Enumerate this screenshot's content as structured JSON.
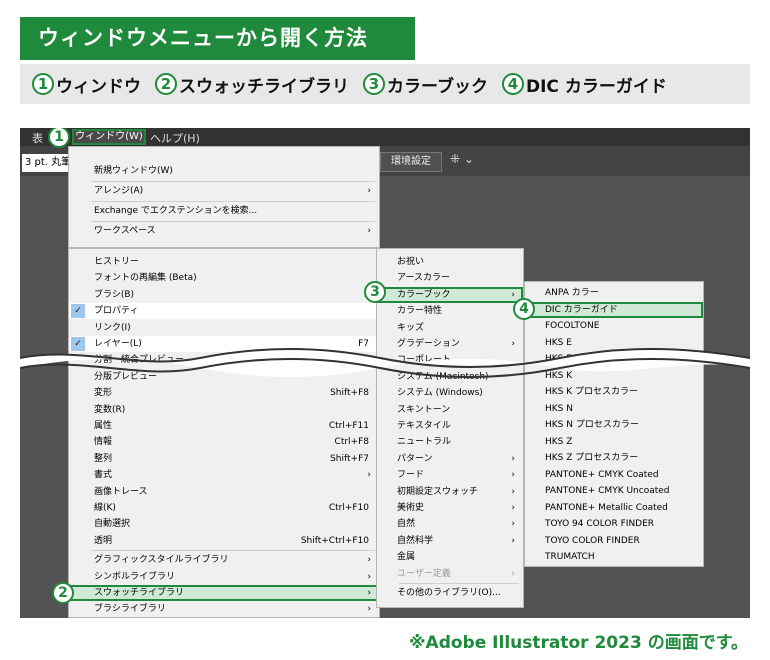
{
  "banner": "ウィンドウメニューから開く方法",
  "steps": [
    {
      "num": "1",
      "label": "ウィンドウ"
    },
    {
      "num": "2",
      "label": "スウォッチライブラリ"
    },
    {
      "num": "3",
      "label": "カラーブック"
    },
    {
      "num": "4",
      "label": "DIC カラーガイド"
    }
  ],
  "menubar": {
    "left_fragment": "表",
    "window": "ウィンドウ(W)",
    "help": "ヘルプ(H)"
  },
  "toolbar": {
    "stroke_field": "3 pt. 丸筆",
    "env_button": "環境設定"
  },
  "window_menu_top": [
    {
      "label": "新規ウィンドウ(W)"
    },
    {
      "label": "アレンジ(A)",
      "submenu": true
    },
    {
      "label": "Exchange でエクステンションを検索..."
    },
    {
      "label": "ワークスペース",
      "submenu": true
    }
  ],
  "window_menu": [
    {
      "label": "ヒストリー"
    },
    {
      "label": "フォントの再編集 (Beta)"
    },
    {
      "label": "ブラシ(B)",
      "shortcut": "F"
    },
    {
      "label": "プロパティ",
      "checked": true
    },
    {
      "label": "リンク(I)"
    },
    {
      "label": "レイヤー(L)",
      "shortcut": "F7",
      "checked": true
    },
    {
      "label": "分割・統合プレビュー"
    },
    {
      "label": "分版プレビュー"
    },
    {
      "label": "変形",
      "shortcut": "Shift+F8"
    },
    {
      "label": "変数(R)"
    },
    {
      "label": "属性",
      "shortcut": "Ctrl+F11"
    },
    {
      "label": "情報",
      "shortcut": "Ctrl+F8"
    },
    {
      "label": "整列",
      "shortcut": "Shift+F7"
    },
    {
      "label": "書式",
      "submenu": true
    },
    {
      "label": "画像トレース"
    },
    {
      "label": "線(K)",
      "shortcut": "Ctrl+F10"
    },
    {
      "label": "自動選択"
    },
    {
      "label": "透明",
      "shortcut": "Shift+Ctrl+F10"
    },
    {
      "label": "グラフィックスタイルライブラリ",
      "submenu": true
    },
    {
      "label": "シンボルライブラリ",
      "submenu": true
    },
    {
      "label": "スウォッチライブラリ",
      "submenu": true,
      "highlight": true
    },
    {
      "label": "ブラシライブラリ",
      "submenu": true
    }
  ],
  "swatch_menu": [
    {
      "label": "お祝い"
    },
    {
      "label": "アースカラー"
    },
    {
      "label": "カラーブック",
      "submenu": true,
      "highlight": true
    },
    {
      "label": "カラー特性"
    },
    {
      "label": "キッズ"
    },
    {
      "label": "グラデーション",
      "submenu": true
    },
    {
      "label": "コーポレート"
    },
    {
      "label": "システム (Macintosh)"
    },
    {
      "label": "システム (Windows)"
    },
    {
      "label": "スキントーン"
    },
    {
      "label": "テキスタイル"
    },
    {
      "label": "ニュートラル"
    },
    {
      "label": "パターン",
      "submenu": true
    },
    {
      "label": "フード",
      "submenu": true
    },
    {
      "label": "初期設定スウォッチ",
      "submenu": true
    },
    {
      "label": "美術史",
      "submenu": true
    },
    {
      "label": "自然",
      "submenu": true
    },
    {
      "label": "自然科学",
      "submenu": true
    },
    {
      "label": "金属"
    },
    {
      "label": "ユーザー定義",
      "submenu": true,
      "disabled": true
    },
    {
      "label": "その他のライブラリ(O)..."
    }
  ],
  "colorbook_menu": [
    {
      "label": "ANPA カラー"
    },
    {
      "label": "DIC カラーガイド",
      "highlight": true
    },
    {
      "label": "FOCOLTONE"
    },
    {
      "label": "HKS E"
    },
    {
      "label": "HKS E プロセスカラー"
    },
    {
      "label": "HKS K"
    },
    {
      "label": "HKS K プロセスカラー"
    },
    {
      "label": "HKS N"
    },
    {
      "label": "HKS N プロセスカラー"
    },
    {
      "label": "HKS Z"
    },
    {
      "label": "HKS Z プロセスカラー"
    },
    {
      "label": "PANTONE+ CMYK Coated"
    },
    {
      "label": "PANTONE+ CMYK Uncoated"
    },
    {
      "label": "PANTONE+ Metallic Coated"
    },
    {
      "label": "TOYO 94 COLOR FINDER"
    },
    {
      "label": "TOYO COLOR FINDER"
    },
    {
      "label": "TRUMATCH"
    }
  ],
  "footnote": "※Adobe Illustrator 2023 の画面です。",
  "colors": {
    "accent": "#1f8a3b",
    "menu_bg": "#f0f0f0",
    "app_bg": "#535353"
  },
  "icons": {
    "submenu": "chevron-right-icon",
    "check": "check-icon"
  }
}
